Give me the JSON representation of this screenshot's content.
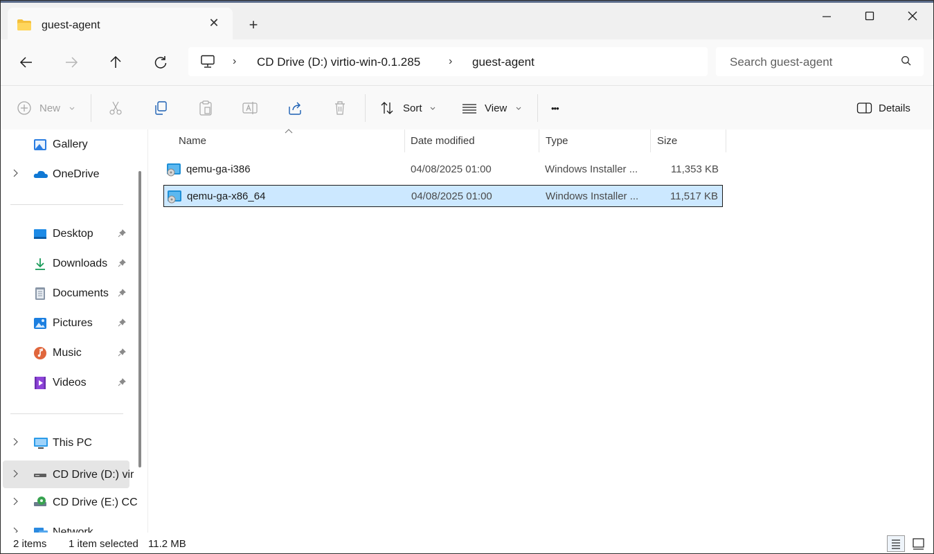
{
  "tab": {
    "title": "guest-agent",
    "close_label": "✕",
    "new_label": "+"
  },
  "address": {
    "segments": [
      "CD Drive (D:) virtio-win-0.1.285",
      "guest-agent"
    ],
    "separator": "›"
  },
  "search": {
    "placeholder": "Search guest-agent"
  },
  "toolbar": {
    "new_label": "New",
    "sort_label": "Sort",
    "view_label": "View",
    "more_label": "•••",
    "details_label": "Details"
  },
  "sidebar": {
    "items": [
      {
        "label": "Gallery",
        "icon": "gallery-icon"
      },
      {
        "label": "OneDrive",
        "icon": "onedrive-icon",
        "expandable": true
      },
      {
        "label": "Desktop",
        "icon": "desktop-icon",
        "pinned": true
      },
      {
        "label": "Downloads",
        "icon": "downloads-icon",
        "pinned": true
      },
      {
        "label": "Documents",
        "icon": "documents-icon",
        "pinned": true
      },
      {
        "label": "Pictures",
        "icon": "pictures-icon",
        "pinned": true
      },
      {
        "label": "Music",
        "icon": "music-icon",
        "pinned": true
      },
      {
        "label": "Videos",
        "icon": "videos-icon",
        "pinned": true
      },
      {
        "label": "This PC",
        "icon": "this-pc-icon",
        "expandable": true
      },
      {
        "label": "CD Drive (D:) vir",
        "icon": "cd-drive-icon",
        "expandable": true,
        "selected": true
      },
      {
        "label": "CD Drive (E:) CC",
        "icon": "cd-drive-icon",
        "expandable": true
      },
      {
        "label": "Network",
        "icon": "network-icon",
        "expandable": true
      }
    ]
  },
  "columns": {
    "name": "Name",
    "date": "Date modified",
    "type": "Type",
    "size": "Size"
  },
  "files": [
    {
      "name": "qemu-ga-i386",
      "date": "04/08/2025 01:00",
      "type": "Windows Installer ...",
      "size": "11,353 KB",
      "selected": false
    },
    {
      "name": "qemu-ga-x86_64",
      "date": "04/08/2025 01:00",
      "type": "Windows Installer ...",
      "size": "11,517 KB",
      "selected": true
    }
  ],
  "status": {
    "count": "2 items",
    "selected": "1 item selected",
    "size": "11.2 MB"
  },
  "colors": {
    "selection": "#cce8ff",
    "accent": "#0067c0",
    "folder": "#f4c03c"
  }
}
